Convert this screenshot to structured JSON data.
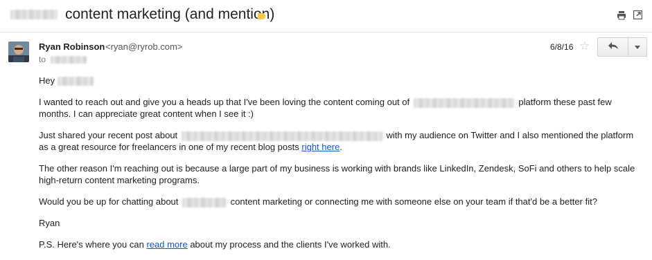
{
  "header": {
    "subject": "content marketing (and mention)",
    "label_color": "#f7c948",
    "print_icon": "print-icon",
    "new_window_icon": "open-in-new-window-icon"
  },
  "message": {
    "sender_name": "Ryan Robinson",
    "sender_email": "<ryan@ryrob.com>",
    "to_label": "to",
    "date": "6/8/16",
    "star": "☆",
    "reply_icon": "reply-icon",
    "more_icon": "caret-down-icon"
  },
  "body": {
    "greeting": "Hey",
    "p1_a": "I wanted to reach out and give you a heads up that I've been loving the content coming out of",
    "p1_b": "platform these past few months. I can appreciate great content when I see it :)",
    "p2_a": "Just shared your recent post about",
    "p2_b": "with my audience on Twitter and I also mentioned the platform as a great resource for freelancers in one of my recent blog posts",
    "p2_link": "right here",
    "p2_end": ".",
    "p3": "The other reason I'm reaching out is because a large part of my business is working with brands like LinkedIn, Zendesk, SoFi and others to help scale high-return content marketing programs.",
    "p4_a": "Would you be up for chatting about",
    "p4_b": "content marketing or connecting me with someone else on your team if that'd be a better fit?",
    "signoff": "Ryan",
    "ps_a": "P.S. Here's where you can",
    "ps_link": "read more",
    "ps_b": "about my process and the clients I've worked with."
  }
}
